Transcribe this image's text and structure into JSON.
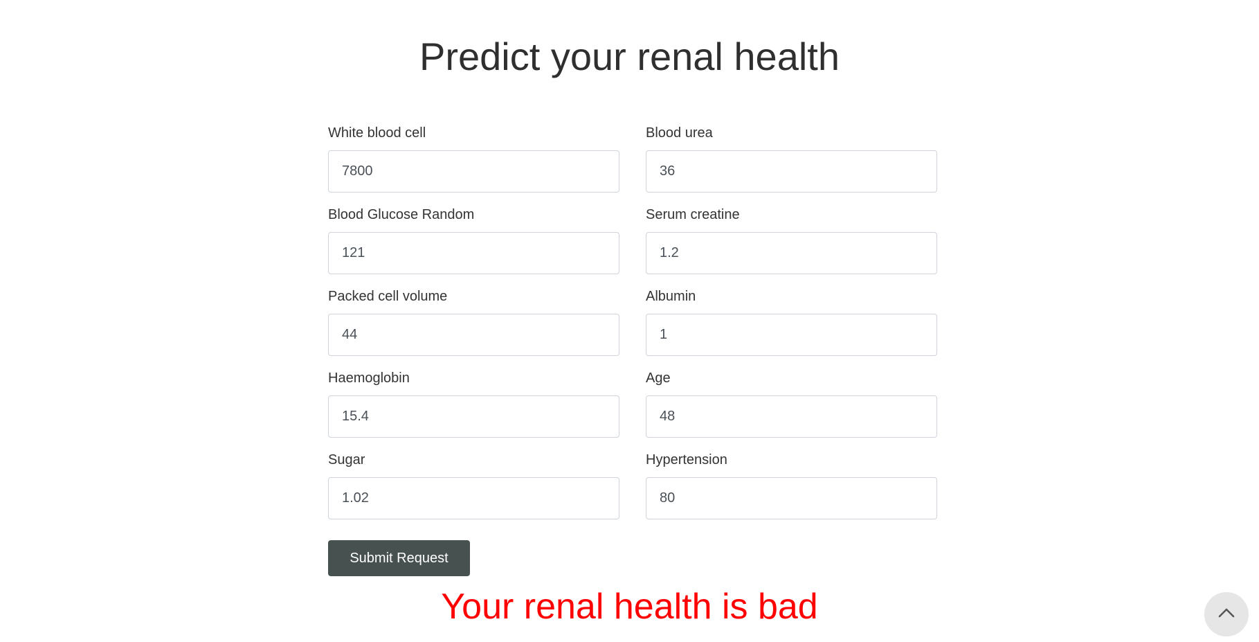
{
  "page": {
    "title": "Predict your renal health"
  },
  "form": {
    "fields": [
      {
        "label": "White blood cell",
        "value": "7800"
      },
      {
        "label": "Blood urea",
        "value": "36"
      },
      {
        "label": "Blood Glucose Random",
        "value": "121"
      },
      {
        "label": "Serum creatine",
        "value": "1.2"
      },
      {
        "label": "Packed cell volume",
        "value": "44"
      },
      {
        "label": "Albumin",
        "value": "1"
      },
      {
        "label": "Haemoglobin",
        "value": "15.4"
      },
      {
        "label": "Age",
        "value": "48"
      },
      {
        "label": "Sugar",
        "value": "1.02"
      },
      {
        "label": "Hypertension",
        "value": "80"
      }
    ],
    "submit_label": "Submit Request"
  },
  "result": {
    "text": "Your renal health is bad",
    "color": "#ff0000"
  },
  "back_to_top": {
    "icon": "chevron-up-icon"
  },
  "colors": {
    "button_bg": "#475250",
    "input_border": "#ced4da",
    "back_to_top_bg": "#e6e6e6"
  }
}
